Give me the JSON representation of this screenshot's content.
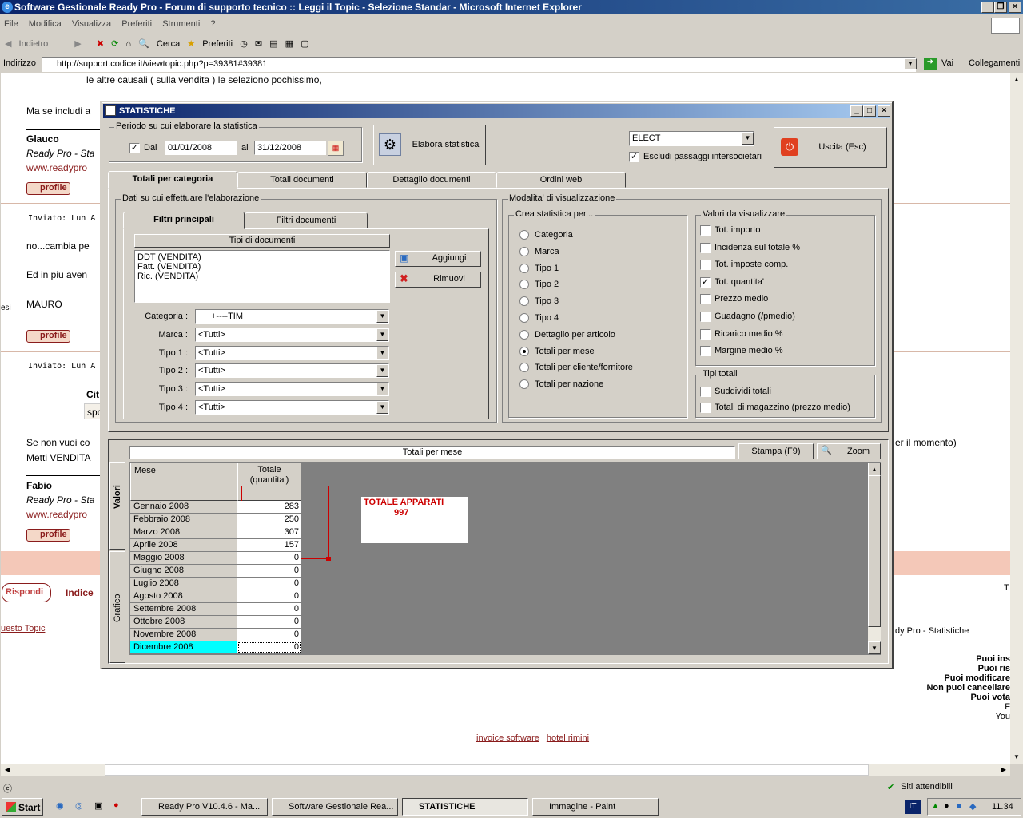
{
  "window": {
    "title": "Software Gestionale Ready Pro - Forum di supporto tecnico :: Leggi il Topic - Selezione Standar - Microsoft Internet Explorer"
  },
  "menu": [
    "File",
    "Modifica",
    "Visualizza",
    "Preferiti",
    "Strumenti",
    "?"
  ],
  "toolbar": {
    "back": "Indietro",
    "search": "Cerca",
    "favorites": "Preferiti"
  },
  "address": {
    "label": "Indirizzo",
    "url": "http://support.codice.it/viewtopic.php?p=39381#39381",
    "go": "Vai",
    "links": "Collegamenti"
  },
  "page": {
    "line1": "le altre causali ( sulla vendita ) le seleziono pochissimo,",
    "line2": "Ma se includi a",
    "author1": "Glauco",
    "sig1": "Ready Pro - Sta",
    "web1": "www.readypro",
    "profile": "profile",
    "posted1": "Inviato: Lun A",
    "msg1": "no...cambia pe",
    "msg2": "Ed in piu aven",
    "msg3": "MAURO",
    "esi": "esi",
    "posted2": "Inviato: Lun A",
    "cit": "Cit",
    "spo": "spo",
    "msg4a": "Se non vuoi co",
    "msg4b": "er il momento)",
    "msg5": "Metti VENDITA",
    "author2": "Fabio",
    "sig2": "Ready Pro - Sta",
    "web2": "www.readypro",
    "reply": "Rispondi",
    "index": "Indice",
    "topic": "uesto Topic",
    "breadcrumb": "dy Pro - Statistiche",
    "t": "T",
    "perms": [
      "Puoi ins",
      "Puoi ris",
      "Puoi modificare",
      "Non puoi cancellare",
      "Puoi vota",
      "F",
      "You"
    ],
    "footer_link1": "invoice software",
    "footer_sep": "|",
    "footer_link2": "hotel rimini"
  },
  "status": {
    "zone": "Siti attendibili"
  },
  "taskbar": {
    "start": "Start",
    "tasks": [
      "Ready Pro V10.4.6 - Ma...",
      "Software Gestionale Rea...",
      "STATISTICHE",
      "Immagine - Paint"
    ],
    "lang": "IT",
    "clock": "11.34"
  },
  "dialog": {
    "title": "STATISTICHE",
    "period_group": "Periodo su cui elaborare la statistica",
    "from_label": "Dal",
    "from": "01/01/2008",
    "to_label": "al",
    "to": "31/12/2008",
    "elaborate": "Elabora statistica",
    "company": "ELECT",
    "exclude": "Escludi passaggi intersocietari",
    "exit": "Uscita (Esc)",
    "tabs": [
      "Totali per categoria",
      "Totali documenti",
      "Dettaglio documenti",
      "Ordini web"
    ],
    "data_group": "Dati su cui effettuare l'elaborazione",
    "subtabs": [
      "Filtri principali",
      "Filtri documenti"
    ],
    "doctypes_header": "Tipi di documenti",
    "doctypes": [
      "DDT (VENDITA)",
      "Fatt. (VENDITA)",
      "Ric. (VENDITA)"
    ],
    "add": "Aggiungi",
    "remove": "Rimuovi",
    "filters": [
      {
        "label": "Categoria :",
        "value": "+----TIM"
      },
      {
        "label": "Marca :",
        "value": "<Tutti>"
      },
      {
        "label": "Tipo 1 :",
        "value": "<Tutti>"
      },
      {
        "label": "Tipo 2 :",
        "value": "<Tutti>"
      },
      {
        "label": "Tipo 3 :",
        "value": "<Tutti>"
      },
      {
        "label": "Tipo 4 :",
        "value": "<Tutti>"
      }
    ],
    "mode_group": "Modalita' di visualizzazione",
    "create_group": "Crea statistica per...",
    "create_opts": [
      "Categoria",
      "Marca",
      "Tipo 1",
      "Tipo 2",
      "Tipo 3",
      "Tipo 4",
      "Dettaglio per articolo",
      "Totali per mese",
      "Totali per cliente/fornitore",
      "Totali per nazione"
    ],
    "create_selected": 7,
    "values_group": "Valori da visualizzare",
    "values_opts": [
      "Tot. importo",
      "Incidenza sul totale %",
      "Tot. imposte comp.",
      "Tot. quantita'",
      "Prezzo medio",
      "Guadagno (/pmedio)",
      "Ricarico medio %",
      "Margine medio %"
    ],
    "values_checked": [
      3
    ],
    "totals_group": "Tipi totali",
    "totals_opts": [
      "Suddividi totali",
      "Totali di magazzino (prezzo medio)"
    ],
    "result_title": "Totali per mese",
    "print": "Stampa (F9)",
    "zoom": "Zoom",
    "vtabs": [
      "Valori",
      "Grafico"
    ],
    "col_month": "Mese",
    "col_total": "Totale (quantita')",
    "rows": [
      {
        "m": "Gennaio 2008",
        "v": "283"
      },
      {
        "m": "Febbraio 2008",
        "v": "250"
      },
      {
        "m": "Marzo 2008",
        "v": "307"
      },
      {
        "m": "Aprile 2008",
        "v": "157"
      },
      {
        "m": "Maggio 2008",
        "v": "0"
      },
      {
        "m": "Giugno 2008",
        "v": "0"
      },
      {
        "m": "Luglio 2008",
        "v": "0"
      },
      {
        "m": "Agosto 2008",
        "v": "0"
      },
      {
        "m": "Settembre 2008",
        "v": "0"
      },
      {
        "m": "Ottobre 2008",
        "v": "0"
      },
      {
        "m": "Novembre 2008",
        "v": "0"
      },
      {
        "m": "Dicembre 2008",
        "v": "0"
      }
    ],
    "annot_title": "TOTALE APPARATI",
    "annot_value": "997"
  },
  "colors": {
    "annotation": "#cc0000",
    "selected_row": "#00ffff",
    "title_bar": "#0a246a"
  }
}
